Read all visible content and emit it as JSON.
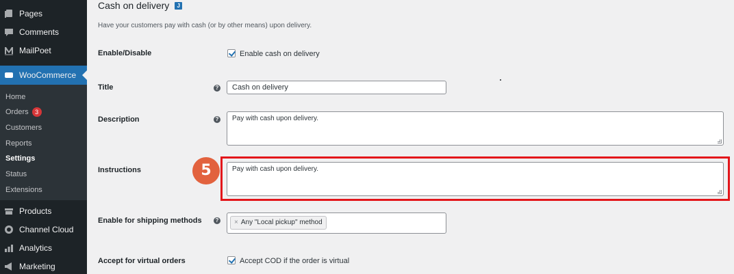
{
  "sidebar": {
    "items_top": [
      {
        "label": "Pages",
        "icon": "pages-icon"
      },
      {
        "label": "Comments",
        "icon": "comments-icon"
      },
      {
        "label": "MailPoet",
        "icon": "mailpoet-icon"
      }
    ],
    "woocommerce": {
      "label": "WooCommerce",
      "icon": "woocommerce-icon"
    },
    "submenu": [
      {
        "label": "Home"
      },
      {
        "label": "Orders",
        "badge": "3"
      },
      {
        "label": "Customers"
      },
      {
        "label": "Reports"
      },
      {
        "label": "Settings",
        "current": true
      },
      {
        "label": "Status"
      },
      {
        "label": "Extensions"
      }
    ],
    "items_bottom": [
      {
        "label": "Products",
        "icon": "products-icon"
      },
      {
        "label": "Channel Cloud",
        "icon": "channel-cloud-icon"
      },
      {
        "label": "Analytics",
        "icon": "analytics-icon"
      },
      {
        "label": "Marketing",
        "icon": "marketing-icon"
      }
    ]
  },
  "page": {
    "title": "Cash on delivery",
    "title_link": "J",
    "description": "Have your customers pay with cash (or by other means) upon delivery."
  },
  "form": {
    "enable": {
      "label": "Enable/Disable",
      "checkbox_label": "Enable cash on delivery",
      "checked": true
    },
    "title": {
      "label": "Title",
      "value": "Cash on delivery"
    },
    "description": {
      "label": "Description",
      "value": "Pay with cash upon delivery."
    },
    "instructions": {
      "label": "Instructions",
      "value": "Pay with cash upon delivery."
    },
    "shipping": {
      "label": "Enable for shipping methods",
      "chip_remove": "×",
      "chip": "Any \"Local pickup\" method"
    },
    "virtual": {
      "label": "Accept for virtual orders",
      "checkbox_label": "Accept COD if the order is virtual",
      "checked": true
    }
  },
  "annotation": {
    "step": "5",
    "highlight_color": "#e3151a",
    "badge_color": "#e2623e"
  },
  "colors": {
    "sidebar_bg": "#1d2327",
    "accent": "#2271b1",
    "page_bg": "#f0f0f1"
  }
}
